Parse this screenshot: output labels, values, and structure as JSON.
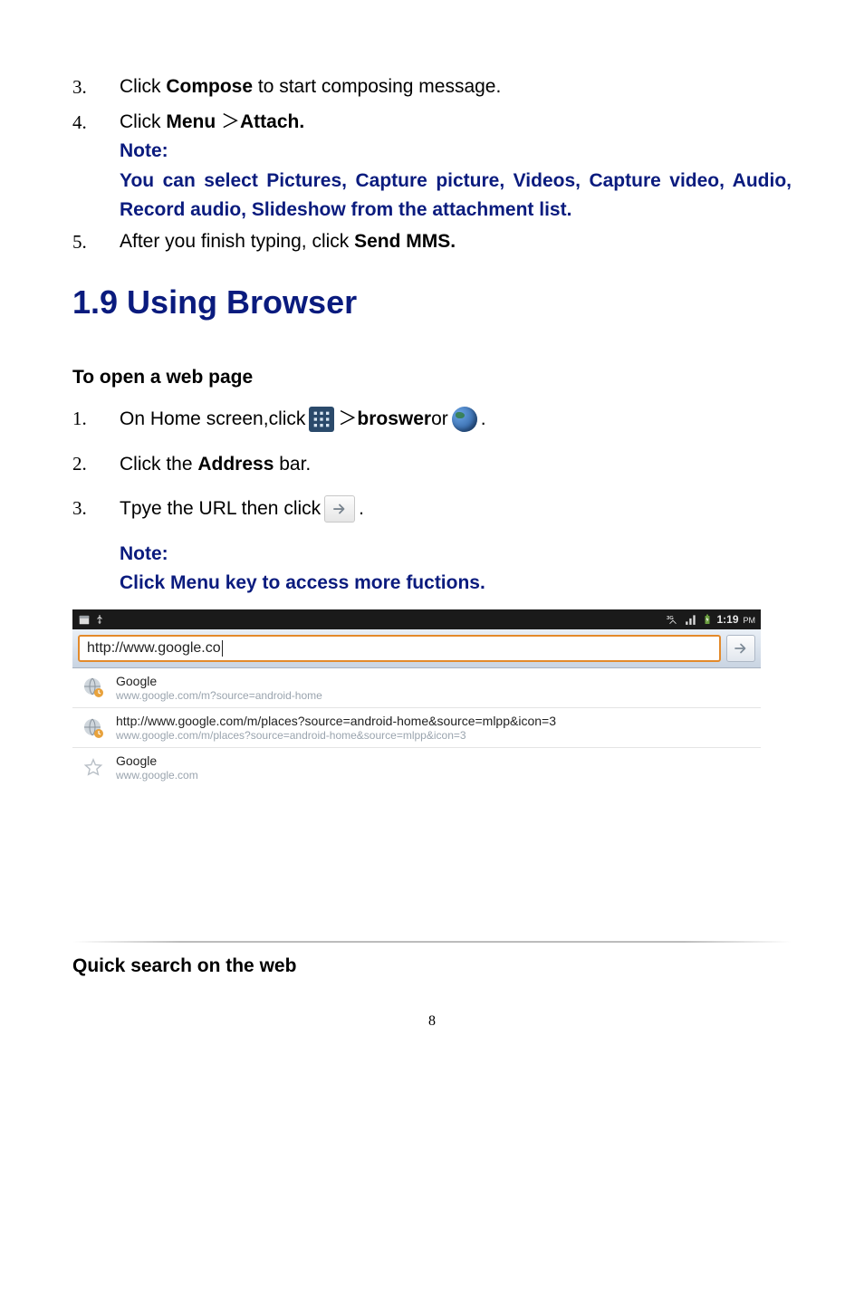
{
  "list1": {
    "item3": {
      "num": "3.",
      "pre": "Click ",
      "b": "Compose",
      "post": " to start composing message."
    },
    "item4": {
      "num": "4.",
      "pre": "Click ",
      "b1": "Menu",
      "sep": " ＞",
      "b2": "Attach."
    },
    "note_label": "Note:",
    "note_body": "You can select Pictures, Capture picture, Videos, Capture video, Audio, Record audio, Slideshow from the attachment list.",
    "item5": {
      "num": "5.",
      "pre": "After you finish typing, click ",
      "b": "Send MMS."
    }
  },
  "section_title": "1.9 Using Browser",
  "subhead1": "To open a web page",
  "steps": {
    "s1": {
      "num": "1.",
      "pre": "On Home screen,click ",
      "sep": " ＞",
      "b": "broswer",
      "post": " or ",
      "tail": "."
    },
    "s2": {
      "num": "2.",
      "pre": "Click the ",
      "b": "Address",
      "post": " bar."
    },
    "s3": {
      "num": "3.",
      "pre": "Tpye the URL then click ",
      "tail": " ."
    }
  },
  "note2_label": "Note:",
  "note2_body": "Click Menu key to access more fuctions.",
  "statusbar": {
    "time": "1:19",
    "pm": "PM"
  },
  "address_value": "http://www.google.co",
  "suggestions": [
    {
      "type": "history",
      "title": "Google",
      "url": "www.google.com/m?source=android-home"
    },
    {
      "type": "history",
      "title": "http://www.google.com/m/places?source=android-home&source=mlpp&icon=3",
      "url": "www.google.com/m/places?source=android-home&source=mlpp&icon=3"
    },
    {
      "type": "bookmark",
      "title": "Google",
      "url": "www.google.com"
    }
  ],
  "quick_head": "Quick search on the web",
  "page_number": "8"
}
